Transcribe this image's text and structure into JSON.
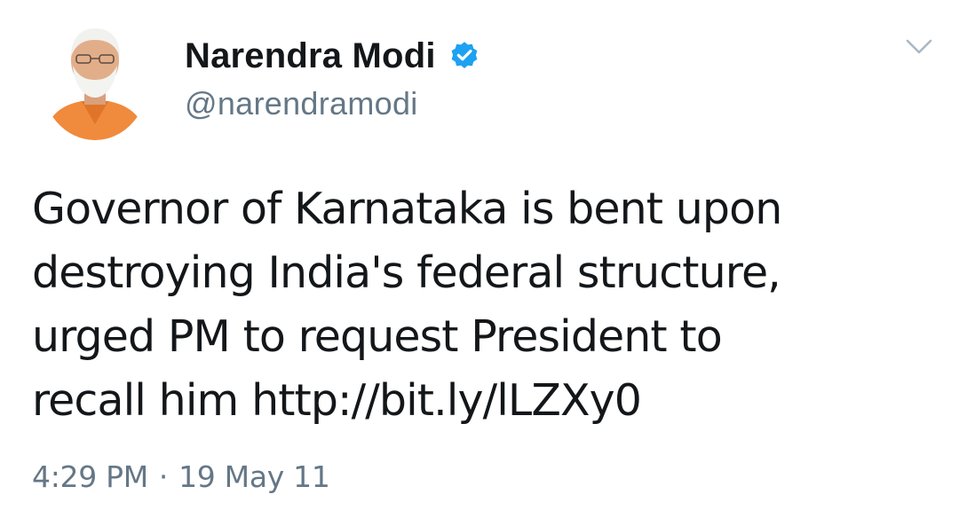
{
  "tweet": {
    "author": {
      "display_name": "Narendra Modi",
      "handle": "@narendramodi",
      "verified": true,
      "avatar_icon": "profile-photo"
    },
    "menu_icon": "chevron-down-icon",
    "text": "Governor of Karnataka is bent upon\ndestroying India's federal structure,\nurged PM to request President to\nrecall him http://bit.ly/lLZXy0",
    "time": "4:29 PM",
    "separator": "·",
    "date": "19 May 11"
  },
  "colors": {
    "verified_badge": "#1da1f2",
    "secondary_text": "#657786",
    "primary_text": "#14171a",
    "saffron_kurta": "#f08a3c"
  }
}
